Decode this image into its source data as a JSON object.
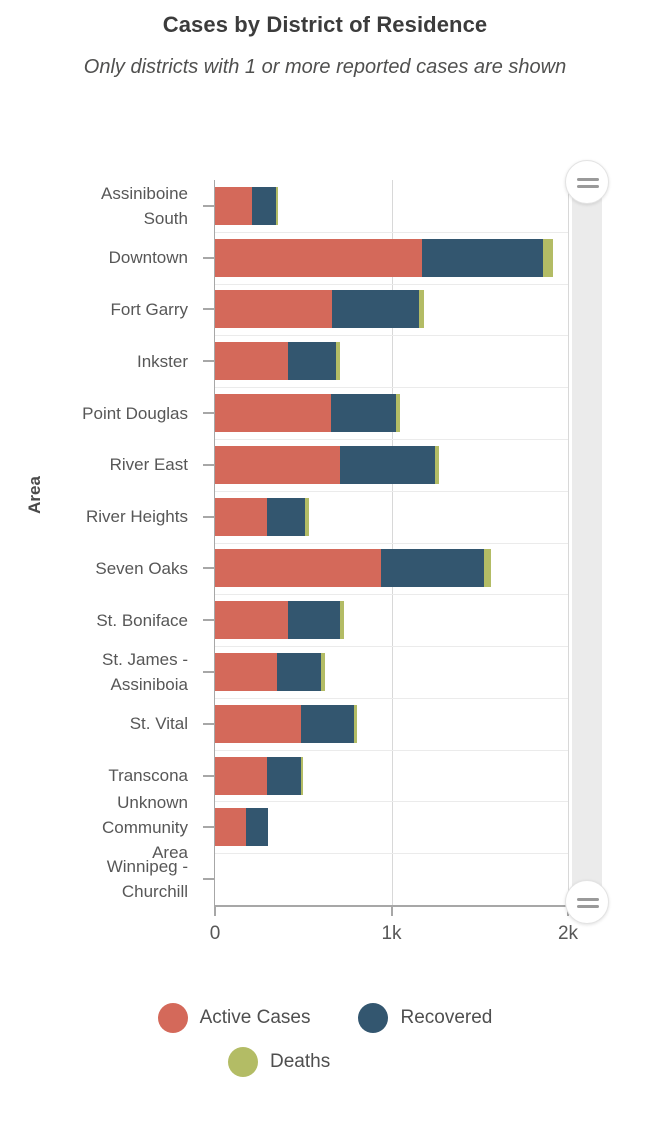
{
  "chart_data": {
    "type": "bar",
    "orientation": "horizontal",
    "stacked": true,
    "title": "Cases by District of Residence",
    "subtitle": "Only districts with 1 or more reported cases are shown",
    "xlabel": "",
    "ylabel": "Area",
    "grid": true,
    "legend_position": "bottom",
    "xlim": [
      0,
      2000
    ],
    "xticks": [
      0,
      1000,
      2000
    ],
    "xtick_labels": [
      "0",
      "1k",
      "2k"
    ],
    "categories": [
      "Assiniboine South",
      "Downtown",
      "Fort Garry",
      "Inkster",
      "Point Douglas",
      "River East",
      "River Heights",
      "Seven Oaks",
      "St. Boniface",
      "St. James - Assiniboia",
      "St. Vital",
      "Transcona",
      "Unknown Community Area",
      "Winnipeg - Churchill"
    ],
    "category_lines": [
      [
        "Assiniboine",
        "South"
      ],
      [
        "Downtown"
      ],
      [
        "Fort Garry"
      ],
      [
        "Inkster"
      ],
      [
        "Point Douglas"
      ],
      [
        "River East"
      ],
      [
        "River Heights"
      ],
      [
        "Seven Oaks"
      ],
      [
        "St. Boniface"
      ],
      [
        "St. James -",
        "Assiniboia"
      ],
      [
        "St. Vital"
      ],
      [
        "Transcona"
      ],
      [
        "Unknown",
        "Community",
        "Area"
      ],
      [
        "Winnipeg -",
        "Churchill"
      ]
    ],
    "series": [
      {
        "name": "Active Cases",
        "color": "#d4695a",
        "values": [
          208,
          1170,
          665,
          411,
          660,
          711,
          297,
          938,
          416,
          354,
          485,
          292,
          173,
          0
        ]
      },
      {
        "name": "Recovered",
        "color": "#33566f",
        "values": [
          136,
          686,
          493,
          272,
          363,
          533,
          215,
          584,
          295,
          249,
          300,
          193,
          125,
          0
        ]
      },
      {
        "name": "Deaths",
        "color": "#b3bc65",
        "values": [
          11,
          57,
          28,
          25,
          28,
          25,
          23,
          40,
          20,
          18,
          20,
          15,
          0,
          0
        ]
      }
    ]
  },
  "legend": {
    "items": [
      {
        "label": "Active Cases",
        "color": "#d4695a"
      },
      {
        "label": "Recovered",
        "color": "#33566f"
      },
      {
        "label": "Deaths",
        "color": "#b3bc65"
      }
    ]
  },
  "scrollbar": {
    "top_handle_icon": "drag-handle-icon",
    "bottom_handle_icon": "drag-handle-icon"
  },
  "colors": {
    "active": "#d4695a",
    "recovered": "#33566f",
    "deaths": "#b3bc65",
    "axis": "#a7a7a7",
    "grid": "#d8d8d8",
    "text": "#575757"
  }
}
